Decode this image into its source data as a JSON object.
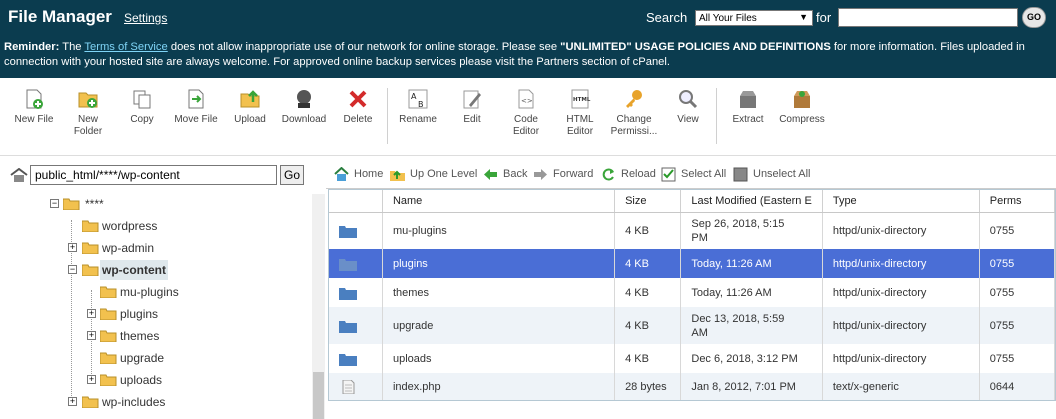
{
  "header": {
    "title": "File Manager",
    "settings_label": "Settings",
    "search_label": "Search",
    "search_scope": "All Your Files",
    "for_label": "for",
    "search_value": "",
    "go_label": "GO"
  },
  "reminder": {
    "prefix": "Reminder:",
    "text1": " The ",
    "tos_link": "Terms of Service",
    "text2": " does not allow inappropriate use of our network for online storage. Please see ",
    "policy": "\"UNLIMITED\" USAGE POLICIES AND DEFINITIONS",
    "text3": " for more information. Files uploaded in connection with your hosted site are always welcome. For approved online backup services please visit the Partners section of cPanel."
  },
  "toolbar": {
    "new_file": "New File",
    "new_folder_1": "New",
    "new_folder_2": "Folder",
    "copy": "Copy",
    "move_file": "Move File",
    "upload": "Upload",
    "download": "Download",
    "delete": "Delete",
    "rename": "Rename",
    "edit": "Edit",
    "code_editor_1": "Code",
    "code_editor_2": "Editor",
    "html_editor_1": "HTML",
    "html_editor_2": "Editor",
    "change_perms_1": "Change",
    "change_perms_2": "Permissi...",
    "view": "View",
    "extract": "Extract",
    "compress": "Compress"
  },
  "tree": {
    "path_value": "public_html/****/wp-content",
    "go_label": "Go",
    "items": [
      {
        "label": "****"
      },
      {
        "label": "wordpress"
      },
      {
        "label": "wp-admin"
      },
      {
        "label": "wp-content"
      },
      {
        "label": "mu-plugins"
      },
      {
        "label": "plugins"
      },
      {
        "label": "themes"
      },
      {
        "label": "upgrade"
      },
      {
        "label": "uploads"
      },
      {
        "label": "wp-includes"
      }
    ]
  },
  "nav": {
    "home": "Home",
    "up": "Up One Level",
    "back": "Back",
    "forward": "Forward",
    "reload": "Reload",
    "select_all": "Select All",
    "unselect_all": "Unselect All"
  },
  "table": {
    "columns": [
      "",
      "Name",
      "Size",
      "Last Modified (Eastern E",
      "Type",
      "Perms"
    ],
    "rows": [
      {
        "name": "mu-plugins",
        "size": "4 KB",
        "modified_1": "Sep 26, 2018, 5:15",
        "modified_2": "PM",
        "type": "httpd/unix-directory",
        "perms": "0755",
        "icon": "folder-icon"
      },
      {
        "name": "plugins",
        "size": "4 KB",
        "modified_1": "Today, 11:26 AM",
        "modified_2": "",
        "type": "httpd/unix-directory",
        "perms": "0755",
        "icon": "folder-icon"
      },
      {
        "name": "themes",
        "size": "4 KB",
        "modified_1": "Today, 11:26 AM",
        "modified_2": "",
        "type": "httpd/unix-directory",
        "perms": "0755",
        "icon": "folder-icon"
      },
      {
        "name": "upgrade",
        "size": "4 KB",
        "modified_1": "Dec 13, 2018, 5:59",
        "modified_2": "AM",
        "type": "httpd/unix-directory",
        "perms": "0755",
        "icon": "folder-icon"
      },
      {
        "name": "uploads",
        "size": "4 KB",
        "modified_1": "Dec 6, 2018, 3:12 PM",
        "modified_2": "",
        "type": "httpd/unix-directory",
        "perms": "0755",
        "icon": "folder-icon"
      },
      {
        "name": "index.php",
        "size": "28 bytes",
        "modified_1": "Jan 8, 2012, 7:01 PM",
        "modified_2": "",
        "type": "text/x-generic",
        "perms": "0644",
        "icon": "file-icon"
      }
    ]
  },
  "colors": {
    "header_bg": "#0b3c4f",
    "selected_row": "#4a6ed6",
    "folder": "#f2c14e",
    "link": "#7fd4f6"
  }
}
